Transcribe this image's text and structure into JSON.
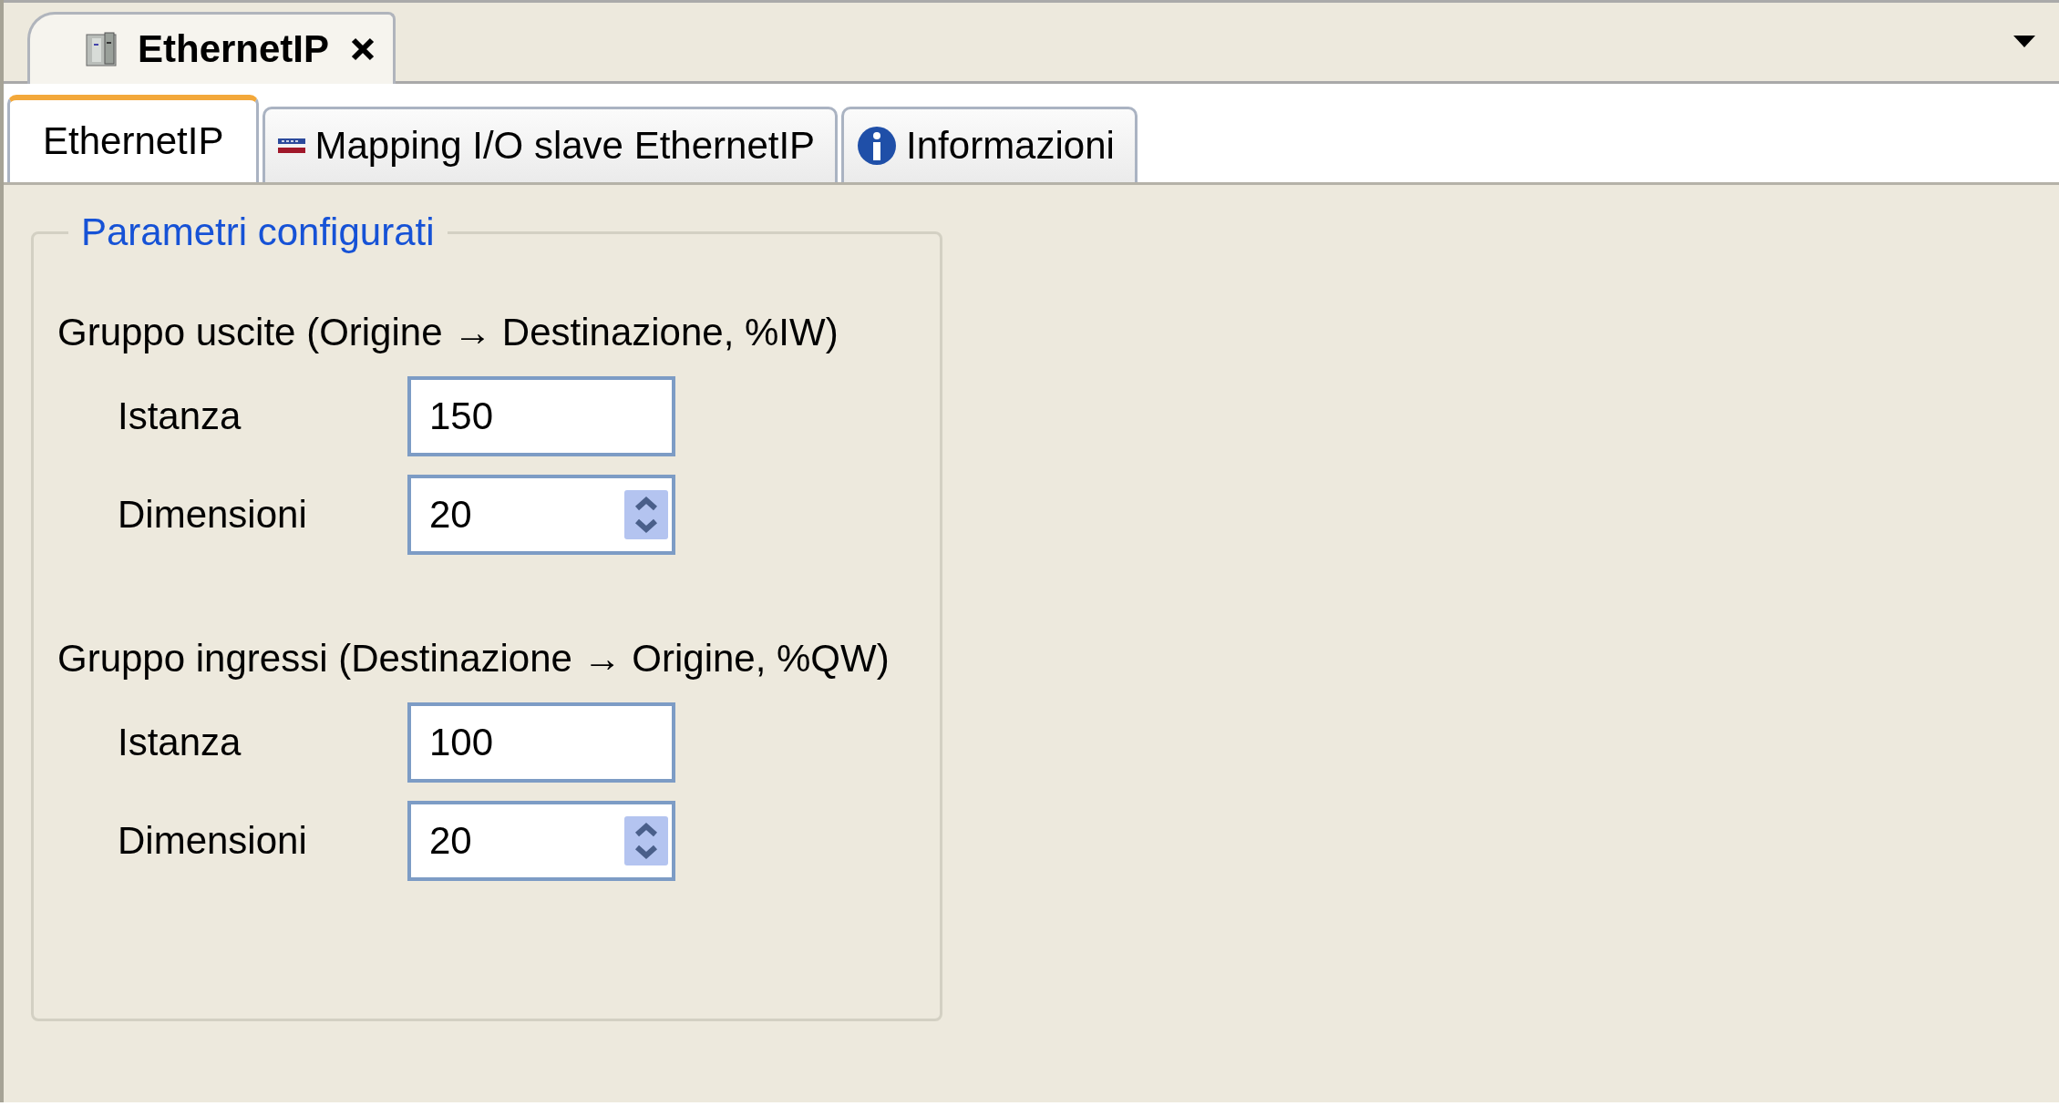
{
  "document_tab": {
    "title": "EthernetIP"
  },
  "tabs": [
    {
      "label": "EthernetIP",
      "selected": true,
      "kind": "plain"
    },
    {
      "label": "Mapping I/O slave EthernetIP",
      "selected": false,
      "kind": "mapping"
    },
    {
      "label": "Informazioni",
      "selected": false,
      "kind": "info"
    }
  ],
  "group": {
    "legend": "Parametri configurati",
    "sections": [
      {
        "heading": "Gruppo uscite (Origine → Destinazione, %IW)",
        "fields": [
          {
            "label": "Istanza",
            "value": "150",
            "kind": "text"
          },
          {
            "label": "Dimensioni",
            "value": "20",
            "kind": "spinner"
          }
        ]
      },
      {
        "heading": "Gruppo ingressi (Destinazione → Origine, %QW)",
        "fields": [
          {
            "label": "Istanza",
            "value": "100",
            "kind": "text"
          },
          {
            "label": "Dimensioni",
            "value": "20",
            "kind": "spinner"
          }
        ]
      }
    ]
  }
}
